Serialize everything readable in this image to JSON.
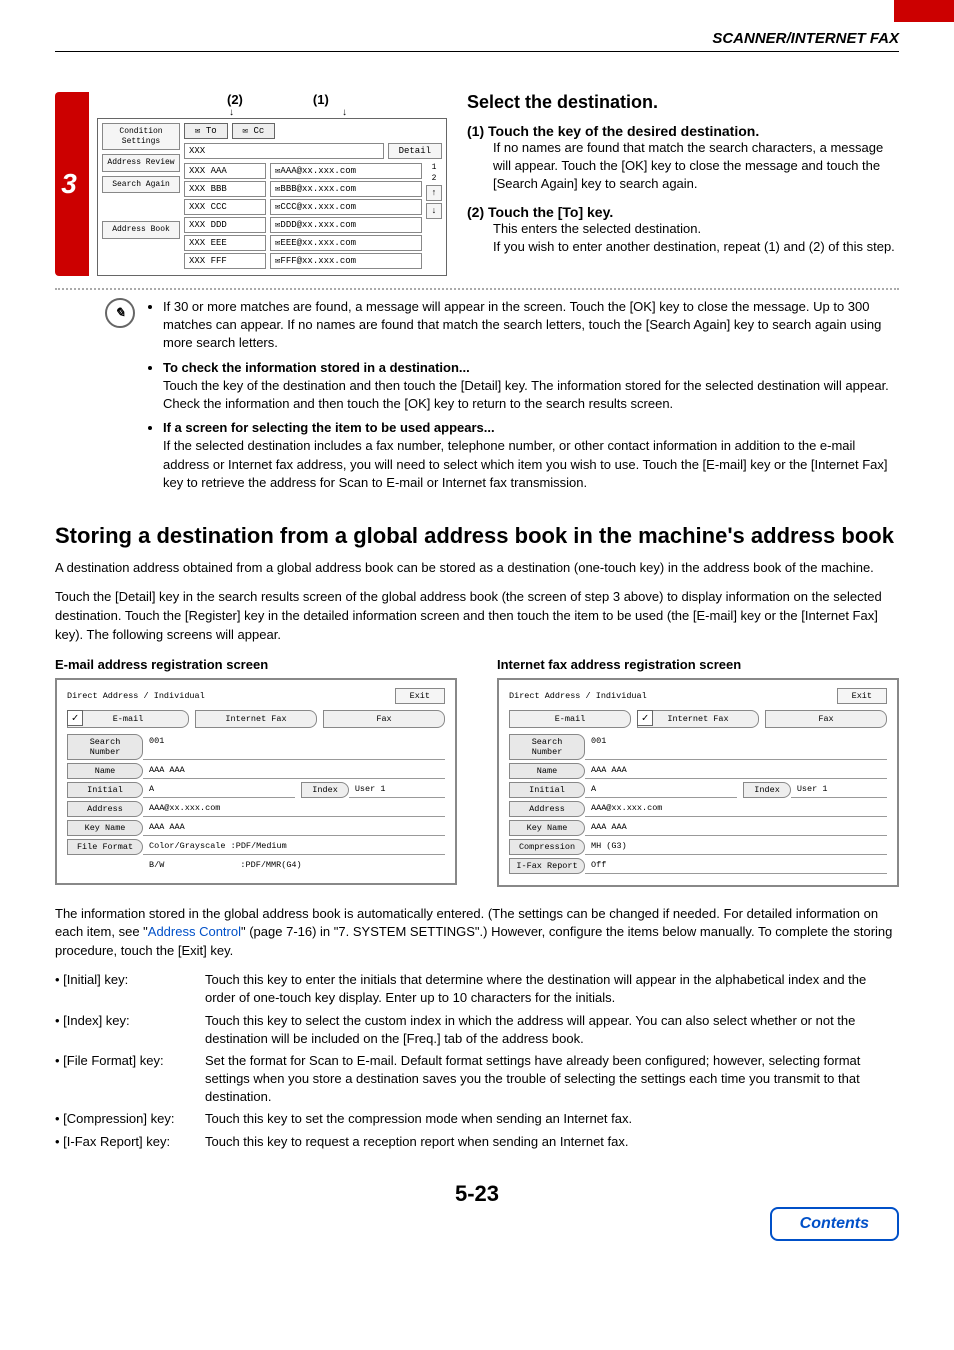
{
  "header": {
    "title": "SCANNER/INTERNET FAX"
  },
  "step": {
    "number": "3",
    "callouts": {
      "c1": "(2)",
      "c2": "(1)"
    },
    "ui": {
      "side": {
        "condition": "Condition Settings",
        "review": "Address Review",
        "search": "Search Again",
        "book": "Address Book"
      },
      "to": "To",
      "cc": "Cc",
      "detail": "Detail",
      "input": "XXX",
      "rows": [
        {
          "l": "XXX AAA",
          "r": "AAA@xx.xxx.com"
        },
        {
          "l": "XXX BBB",
          "r": "BBB@xx.xxx.com"
        },
        {
          "l": "XXX CCC",
          "r": "CCC@xx.xxx.com"
        },
        {
          "l": "XXX DDD",
          "r": "DDD@xx.xxx.com"
        },
        {
          "l": "XXX EEE",
          "r": "EEE@xx.xxx.com"
        },
        {
          "l": "XXX FFF",
          "r": "FFF@xx.xxx.com"
        }
      ],
      "scroll": {
        "up": "↑",
        "down": "↓",
        "pg1": "1",
        "pg2": "2"
      }
    },
    "instr": {
      "title": "Select the destination.",
      "i1_head": "(1)  Touch the key of the desired destination.",
      "i1_body": "If no names are found that match the search characters, a message will appear. Touch the [OK] key to close the message and touch the [Search Again] key to search again.",
      "i2_head": "(2)  Touch the [To] key.",
      "i2_body1": "This enters the selected destination.",
      "i2_body2": "If you wish to enter another destination, repeat (1) and (2) of this step."
    }
  },
  "notes": {
    "b1": "If 30 or more matches are found, a message will appear in the screen. Touch the [OK] key to close the message. Up to 300 matches can appear. If no names are found that match the search letters, touch the [Search Again] key to search again using more search letters.",
    "b2_head": "To check the information stored in a destination...",
    "b2_body": "Touch the key of the destination and then touch the [Detail] key. The information stored for the selected destination will appear. Check the information and then touch the [OK] key to return to the search results screen.",
    "b3_head": "If a screen for selecting the item to be used appears...",
    "b3_body": "If the selected destination includes a fax number, telephone number, or other contact information in addition to the e-mail address or Internet fax address, you will need to select which item you wish to use. Touch the [E-mail] key or the [Internet Fax] key to retrieve the address for Scan to E-mail or Internet fax transmission."
  },
  "section_title": "Storing a destination from a global address book in the machine's address book",
  "p1": "A destination address obtained from a global address book can be stored as a destination (one-touch key) in the address book of the machine.",
  "p2": "Touch the [Detail] key in the search results screen of the global address book (the screen of step 3 above) to display information on the selected destination. Touch the [Register] key in the detailed information screen and then touch the item to be used (the [E-mail] key or the [Internet Fax] key). The following screens will appear.",
  "reg": {
    "email_title": "E-mail address registration screen",
    "ifax_title": "Internet fax address registration screen",
    "breadcrumb": "Direct Address / Individual",
    "exit": "Exit",
    "tab_email": "E-mail",
    "tab_ifax": "Internet Fax",
    "tab_fax": "Fax",
    "check": "✓",
    "f_search": "Search Number",
    "v_search": "001",
    "f_name": "Name",
    "v_name": "AAA AAA",
    "f_initial": "Initial",
    "v_initial": "A",
    "idx": "Index",
    "idx_v": "User 1",
    "f_addr": "Address",
    "v_addr": "AAA@xx.xxx.com",
    "f_key": "Key Name",
    "v_key": "AAA AAA",
    "f_format": "File Format",
    "v_format1": "Color/Grayscale :PDF/Medium",
    "v_format2_l": "B/W",
    "v_format2_r": ":PDF/MMR(G4)",
    "f_comp": "Compression",
    "v_comp": "MH (G3)",
    "f_rep": "I-Fax Report",
    "v_rep": "Off"
  },
  "p3a": "The information stored in the global address book is automatically entered. (The settings can be changed if needed. For detailed information on each item, see \"",
  "p3_link": "Address Control",
  "p3b": "\" (page 7-16) in \"7. SYSTEM SETTINGS\".) However, configure the items below manually. To complete the storing procedure, touch the [Exit] key.",
  "defs": {
    "k1": "• [Initial] key:",
    "v1": "Touch this key to enter the initials that determine where the destination will appear in the alphabetical index and the order of one-touch key display. Enter up to 10 characters for the initials.",
    "k2": "• [Index] key:",
    "v2": "Touch this key to select the custom index in which the address will appear. You can also select whether or not the destination will be included on the [Freq.] tab of the address book.",
    "k3": "• [File Format] key:",
    "v3": "Set the format for Scan to E-mail. Default format settings have already been configured; however, selecting format settings when you store a destination saves you the trouble of selecting the settings each time you transmit to that destination.",
    "k4": "• [Compression] key:",
    "v4": "Touch this key to set the compression mode when sending an Internet fax.",
    "k5": "• [I-Fax Report] key:",
    "v5": "Touch this key to request a reception report when sending an Internet fax."
  },
  "footer": {
    "page": "5-23",
    "contents": "Contents"
  }
}
